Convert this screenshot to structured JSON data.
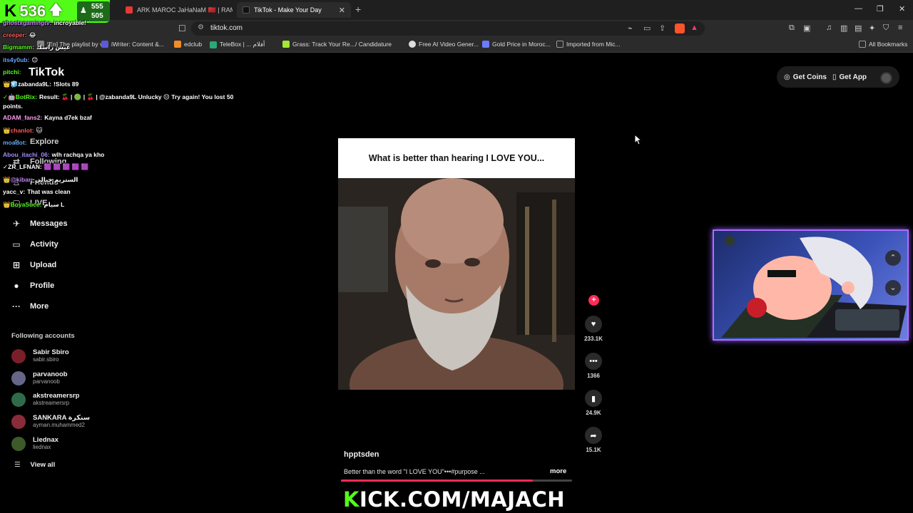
{
  "browser": {
    "tabs": [
      {
        "label": "ARK MAROC JaHaNaM 🇲🇦 | RAMA",
        "favicon_color": "#e53935"
      },
      {
        "label": "TikTok - Make Your Day",
        "favicon_color": "#111111",
        "close": "✕"
      }
    ],
    "new_tab": "+",
    "window_controls": {
      "minimize": "—",
      "restore": "❐",
      "close": "✕"
    },
    "url": "tiktok.com",
    "bookmarks": [
      {
        "label": "[En] The playlist by v...",
        "color": "#888888"
      },
      {
        "label": "iWriter: Content &...",
        "color": "#5b5bd6"
      },
      {
        "label": "edclub",
        "color": "#f28c28"
      },
      {
        "label": "TeleBox | ... أفلام",
        "color": "#2aa876"
      },
      {
        "label": "Grass: Track Your Re...",
        "color": "#a3e635"
      },
      {
        "label": "/ Candidature",
        "color": "#2b2b2b"
      },
      {
        "label": "Free AI Video Gener...",
        "color": "#dddddd"
      },
      {
        "label": "Gold Price in Moroc...",
        "color": "#6b7cff"
      },
      {
        "label": "Imported from Mic...",
        "color": "#999999"
      }
    ],
    "all_bookmarks": "All Bookmarks"
  },
  "kick": {
    "logo": "K",
    "count": "536",
    "arrow": "🡅",
    "sub_a": "555",
    "sub_b": "505",
    "banner_k": "K",
    "banner_rest": "ICK.COM/MAJACH"
  },
  "chat": [
    {
      "user": "ghostxgamingtv:",
      "msg": "incroyable!",
      "color": "#c084fc"
    },
    {
      "user": "creeper:",
      "msg": "😂",
      "color": "#ff5a5a"
    },
    {
      "user": "Bigmamm:",
      "msg": "عيش راسك",
      "color": "#53fc18"
    },
    {
      "user": "its4y0ub:",
      "msg": "😊",
      "color": "#60a5fa"
    },
    {
      "user": "pitchi:",
      "msg": "",
      "color": "#53fc18"
    },
    {
      "user": "👑🧊zabanda9L:",
      "msg": "!Slots 89",
      "color": "#ffffff"
    },
    {
      "user": "✓🤖BotRix:",
      "msg": "Result: 🍒 | 🟢 | 🍒 | @zabanda9L Unlucky 😔 Try again! You lost 50 points.",
      "color": "#53fc18"
    },
    {
      "user": "ADAM_fans2:",
      "msg": "Kayna d7ek bzaf",
      "color": "#ff9cf0"
    },
    {
      "user": "👑chanlot:",
      "msg": "🐱",
      "color": "#ff5a5a"
    },
    {
      "user": "moadot:",
      "msg": "",
      "color": "#60a5fa"
    },
    {
      "user": "Abou_itachi_06:",
      "msg": "wlh rachqa ya kho",
      "color": "#a78bfa"
    },
    {
      "user": "✓ZR_LFNAN:",
      "msg": "🟪 🟪 🟪 🟪 🟪",
      "color": "#ffffff"
    },
    {
      "user": "👑@kibar:",
      "msg": "الستريم خيالي",
      "color": "#c084fc"
    },
    {
      "user": "yacc_v:",
      "msg": "That was clean",
      "color": "#ffffff"
    },
    {
      "user": "👑BoyaSuce:",
      "msg": "سيام L",
      "color": "#53fc18"
    }
  ],
  "tiktok": {
    "logo": "TikTok",
    "nav": [
      {
        "label": "Explore",
        "icon": "⌕",
        "name": "explore"
      },
      {
        "label": "Following",
        "icon": "⇄",
        "name": "following"
      },
      {
        "label": "Friends",
        "icon": "♙",
        "name": "friends"
      },
      {
        "label": "LIVE",
        "icon": "▢",
        "name": "live"
      },
      {
        "label": "Messages",
        "icon": "✈",
        "name": "messages"
      },
      {
        "label": "Activity",
        "icon": "▭",
        "name": "activity"
      },
      {
        "label": "Upload",
        "icon": "⊞",
        "name": "upload"
      },
      {
        "label": "Profile",
        "icon": "●",
        "name": "profile"
      },
      {
        "label": "More",
        "icon": "···",
        "name": "more"
      }
    ],
    "following_header": "Following accounts",
    "accounts": [
      {
        "name": "Sabir Sbiro",
        "handle": "sabir.sbiro",
        "color": "#7a1f2a"
      },
      {
        "name": "parvanoob",
        "handle": "parvanoob",
        "color": "#666688"
      },
      {
        "name": "akstreamersrp",
        "handle": "akstreamersrp",
        "color": "#2f6b4a"
      },
      {
        "name": "SANKARA سنكرة",
        "handle": "ayman.muhammed2",
        "color": "#8a2b3a"
      },
      {
        "name": "Liednax",
        "handle": "liednax",
        "color": "#3d5a2a"
      }
    ],
    "view_all": "View all",
    "get_coins": "Get Coins",
    "get_app": "Get App",
    "video": {
      "caption": "What is better than hearing I LOVE YOU...",
      "author": "hpptsden",
      "description": "Better than the word \"I LOVE YOU\"•••#purpose ...",
      "more": "more",
      "progress_fraction": 0.83
    },
    "actions": {
      "likes": "233.1K",
      "comments": "1366",
      "saves": "24.9K",
      "shares": "15.1K"
    }
  }
}
